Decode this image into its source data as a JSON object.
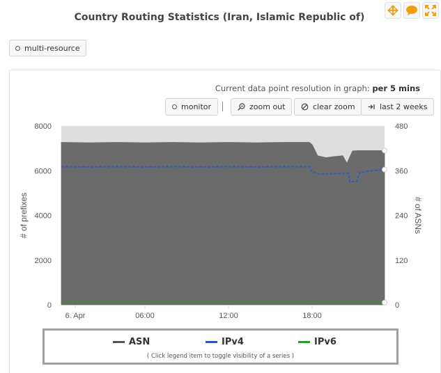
{
  "widget": {
    "title": "Country Routing Statistics (Iran, Islamic Republic of)",
    "icons": [
      "move-icon",
      "comment-icon",
      "fullscreen-icon"
    ],
    "accent_color": "#f39c12"
  },
  "multi_resource_label": "multi-resource",
  "resolution": {
    "prefix": "Current data point resolution in graph:",
    "value": "per 5 mins"
  },
  "toolbar": {
    "monitor_label": "monitor",
    "zoom_out_label": "zoom out",
    "clear_zoom_label": "clear zoom",
    "last_2_weeks_label": "last 2 weeks"
  },
  "legend": {
    "items": [
      {
        "label": "ASN",
        "color": "#555555"
      },
      {
        "label": "IPv4",
        "color": "#2f5bb7"
      },
      {
        "label": "IPv6",
        "color": "#2e9a2e"
      }
    ],
    "hint": "( Click legend item to toggle visibility of a series )"
  },
  "chart_data": {
    "type": "area",
    "ylabel_left": "# of prefixes",
    "ylabel_right": "# of ASNs",
    "y_left_ticks": [
      "0",
      "2000",
      "4000",
      "6000",
      "8000"
    ],
    "y_right_ticks": [
      "0",
      "120",
      "240",
      "360",
      "480"
    ],
    "y_left_range": [
      0,
      8000
    ],
    "y_right_range": [
      0,
      480
    ],
    "x_tick_labels": [
      "6. Apr",
      "06:00",
      "12:00",
      "18:00"
    ],
    "x_tick_hours": [
      1,
      6,
      12,
      18
    ],
    "x_range_hours": [
      0,
      23.2
    ],
    "grid": false,
    "background_band": {
      "name": "total",
      "color": "#dedede",
      "value": 8000
    },
    "series": [
      {
        "name": "ASN",
        "axis": "right",
        "color": "#6b6b6b",
        "x": [
          0,
          2,
          4,
          6,
          8,
          10,
          12,
          14,
          16,
          17.8,
          18,
          18.4,
          19,
          19.6,
          20.2,
          20.5,
          20.9,
          21.3,
          22,
          23.2
        ],
        "values": [
          436,
          435,
          436,
          435,
          436,
          435,
          436,
          435,
          436,
          436,
          430,
          400,
          395,
          398,
          400,
          380,
          413,
          414,
          414,
          414
        ]
      },
      {
        "name": "IPv4",
        "color": "#2f5bb7",
        "x": [
          0,
          2,
          4,
          6,
          8,
          10,
          12,
          14,
          16,
          17.8,
          18,
          18.5,
          19.2,
          20,
          20.6,
          20.7,
          21.2,
          21.4,
          22,
          23.2
        ],
        "values": [
          6180,
          6170,
          6180,
          6170,
          6180,
          6170,
          6180,
          6170,
          6180,
          6180,
          5950,
          5850,
          5860,
          5870,
          5880,
          5500,
          5520,
          5900,
          5980,
          6050
        ]
      },
      {
        "name": "IPv6",
        "color": "#2e9a2e",
        "x": [
          0,
          23.2
        ],
        "values": [
          100,
          100
        ]
      }
    ]
  }
}
